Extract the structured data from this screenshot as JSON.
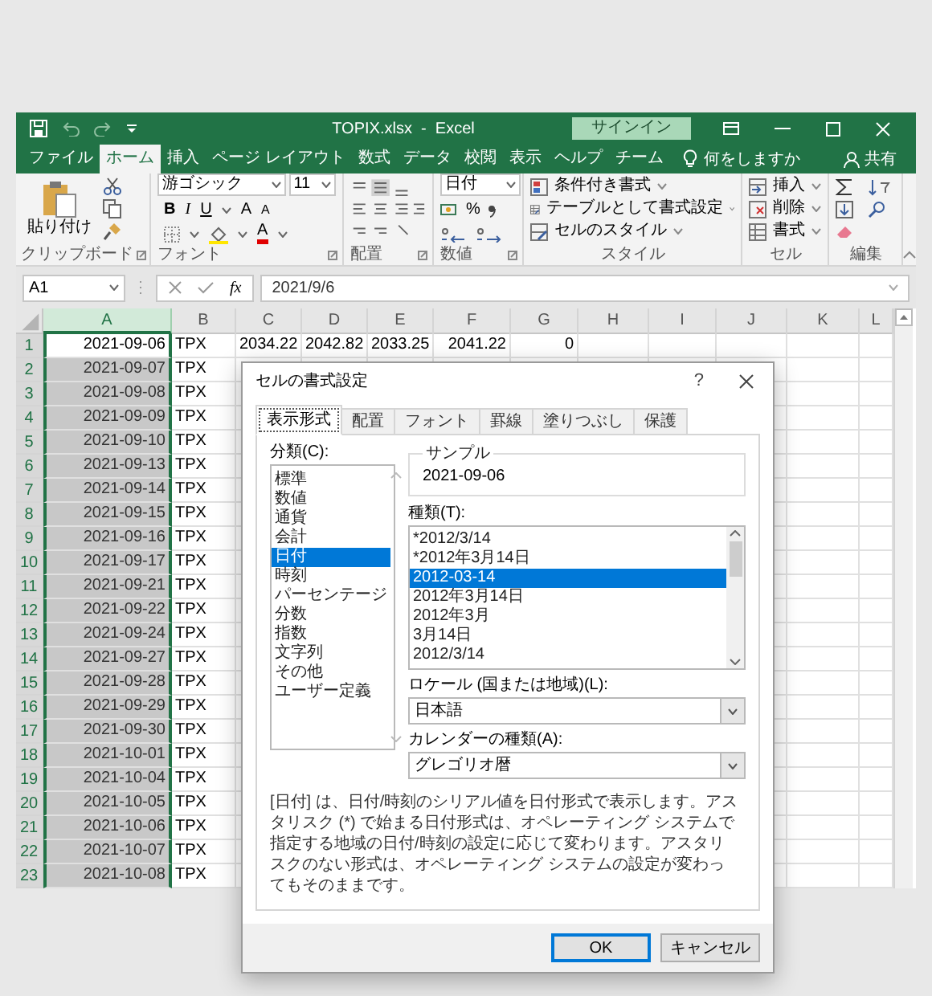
{
  "window": {
    "title": "TOPIX.xlsx  -  Excel",
    "sign_in": "サインイン"
  },
  "ribbon_tabs": [
    {
      "label": "ファイル",
      "selected": false
    },
    {
      "label": "ホーム",
      "selected": true
    },
    {
      "label": "挿入",
      "selected": false
    },
    {
      "label": "ページ レイアウト",
      "selected": false
    },
    {
      "label": "数式",
      "selected": false
    },
    {
      "label": "データ",
      "selected": false
    },
    {
      "label": "校閲",
      "selected": false
    },
    {
      "label": "表示",
      "selected": false
    },
    {
      "label": "ヘルプ",
      "selected": false
    },
    {
      "label": "チーム",
      "selected": false
    }
  ],
  "tell_me": "何をしますか",
  "share": "共有",
  "ribbon": {
    "clipboard": {
      "paste": "貼り付け",
      "group": "クリップボード"
    },
    "font": {
      "name": "游ゴシック",
      "size": "11",
      "bold": "B",
      "italic": "I",
      "underline": "U",
      "grow": "A",
      "shrink": "A",
      "font_color_label": "A",
      "group": "フォント"
    },
    "alignment": {
      "group": "配置"
    },
    "number": {
      "format": "日付",
      "percent": "%",
      "group": "数値"
    },
    "styles": {
      "items": [
        "条件付き書式",
        "テーブルとして書式設定",
        "セルのスタイル"
      ],
      "group": "スタイル"
    },
    "cells": {
      "items": [
        "挿入",
        "削除",
        "書式"
      ],
      "group": "セル"
    },
    "editing": {
      "group": "編集"
    }
  },
  "formula_bar": {
    "name_box": "A1",
    "fx": "fx",
    "value": "2021/9/6"
  },
  "sheet": {
    "columns": [
      {
        "label": "A",
        "selected": true
      },
      {
        "label": "B",
        "selected": false
      },
      {
        "label": "C",
        "selected": false
      },
      {
        "label": "D",
        "selected": false
      },
      {
        "label": "E",
        "selected": false
      },
      {
        "label": "F",
        "selected": false
      },
      {
        "label": "G",
        "selected": false
      },
      {
        "label": "H",
        "selected": false
      },
      {
        "label": "I",
        "selected": false
      },
      {
        "label": "J",
        "selected": false
      },
      {
        "label": "K",
        "selected": false
      },
      {
        "label": "L",
        "selected": false
      }
    ],
    "rows": [
      {
        "number": "1",
        "active": true,
        "selected": true,
        "cells": [
          "2021-09-06",
          "TPX",
          "2034.22",
          "2042.82",
          "2033.25",
          "2041.22",
          "0"
        ]
      },
      {
        "number": "2",
        "active": false,
        "selected": true,
        "cells": [
          "2021-09-07",
          "TPX"
        ]
      },
      {
        "number": "3",
        "active": false,
        "selected": true,
        "cells": [
          "2021-09-08",
          "TPX"
        ]
      },
      {
        "number": "4",
        "active": false,
        "selected": true,
        "cells": [
          "2021-09-09",
          "TPX"
        ]
      },
      {
        "number": "5",
        "active": false,
        "selected": true,
        "cells": [
          "2021-09-10",
          "TPX"
        ]
      },
      {
        "number": "6",
        "active": false,
        "selected": true,
        "cells": [
          "2021-09-13",
          "TPX"
        ]
      },
      {
        "number": "7",
        "active": false,
        "selected": true,
        "cells": [
          "2021-09-14",
          "TPX"
        ]
      },
      {
        "number": "8",
        "active": false,
        "selected": true,
        "cells": [
          "2021-09-15",
          "TPX"
        ]
      },
      {
        "number": "9",
        "active": false,
        "selected": true,
        "cells": [
          "2021-09-16",
          "TPX"
        ]
      },
      {
        "number": "10",
        "active": false,
        "selected": true,
        "cells": [
          "2021-09-17",
          "TPX"
        ]
      },
      {
        "number": "11",
        "active": false,
        "selected": true,
        "cells": [
          "2021-09-21",
          "TPX"
        ]
      },
      {
        "number": "12",
        "active": false,
        "selected": true,
        "cells": [
          "2021-09-22",
          "TPX"
        ]
      },
      {
        "number": "13",
        "active": false,
        "selected": true,
        "cells": [
          "2021-09-24",
          "TPX"
        ]
      },
      {
        "number": "14",
        "active": false,
        "selected": true,
        "cells": [
          "2021-09-27",
          "TPX"
        ]
      },
      {
        "number": "15",
        "active": false,
        "selected": true,
        "cells": [
          "2021-09-28",
          "TPX"
        ]
      },
      {
        "number": "16",
        "active": false,
        "selected": true,
        "cells": [
          "2021-09-29",
          "TPX"
        ]
      },
      {
        "number": "17",
        "active": false,
        "selected": true,
        "cells": [
          "2021-09-30",
          "TPX"
        ]
      },
      {
        "number": "18",
        "active": false,
        "selected": true,
        "cells": [
          "2021-10-01",
          "TPX"
        ]
      },
      {
        "number": "19",
        "active": false,
        "selected": true,
        "cells": [
          "2021-10-04",
          "TPX"
        ]
      },
      {
        "number": "20",
        "active": false,
        "selected": true,
        "cells": [
          "2021-10-05",
          "TPX"
        ]
      },
      {
        "number": "21",
        "active": false,
        "selected": true,
        "cells": [
          "2021-10-06",
          "TPX"
        ]
      },
      {
        "number": "22",
        "active": false,
        "selected": true,
        "cells": [
          "2021-10-07",
          "TPX"
        ]
      },
      {
        "number": "23",
        "active": false,
        "selected": true,
        "cells": [
          "2021-10-08",
          "TPX"
        ]
      }
    ]
  },
  "dialog": {
    "title": "セルの書式設定",
    "help": "?",
    "tabs": [
      {
        "label": "表示形式",
        "selected": true
      },
      {
        "label": "配置",
        "selected": false
      },
      {
        "label": "フォント",
        "selected": false
      },
      {
        "label": "罫線",
        "selected": false
      },
      {
        "label": "塗りつぶし",
        "selected": false
      },
      {
        "label": "保護",
        "selected": false
      }
    ],
    "category_label": "分類(C):",
    "categories": [
      {
        "label": "標準",
        "selected": false
      },
      {
        "label": "数値",
        "selected": false
      },
      {
        "label": "通貨",
        "selected": false
      },
      {
        "label": "会計",
        "selected": false
      },
      {
        "label": "日付",
        "selected": true
      },
      {
        "label": "時刻",
        "selected": false
      },
      {
        "label": "パーセンテージ",
        "selected": false
      },
      {
        "label": "分数",
        "selected": false
      },
      {
        "label": "指数",
        "selected": false
      },
      {
        "label": "文字列",
        "selected": false
      },
      {
        "label": "その他",
        "selected": false
      },
      {
        "label": "ユーザー定義",
        "selected": false
      }
    ],
    "sample_label": "サンプル",
    "sample": "2021-09-06",
    "type_label": "種類(T):",
    "types": [
      {
        "label": "*2012/3/14",
        "selected": false
      },
      {
        "label": "*2012年3月14日",
        "selected": false
      },
      {
        "label": "2012-03-14",
        "selected": true
      },
      {
        "label": "2012年3月14日",
        "selected": false
      },
      {
        "label": "2012年3月",
        "selected": false
      },
      {
        "label": "3月14日",
        "selected": false
      },
      {
        "label": "2012/3/14",
        "selected": false
      }
    ],
    "locale_label": "ロケール (国または地域)(L):",
    "locale": "日本語",
    "calendar_label": "カレンダーの種類(A):",
    "calendar": "グレゴリオ暦",
    "description": "[日付] は、日付/時刻のシリアル値を日付形式で表示します。アスタリスク (*) で始まる日付形式は、オペレーティング システムで指定する地域の日付/時刻の設定に応じて変わります。アスタリスクのない形式は、オペレーティング システムの設定が変わってもそのままです。",
    "buttons": [
      {
        "label": "OK",
        "default": true
      },
      {
        "label": "キャンセル",
        "default": false
      }
    ]
  }
}
